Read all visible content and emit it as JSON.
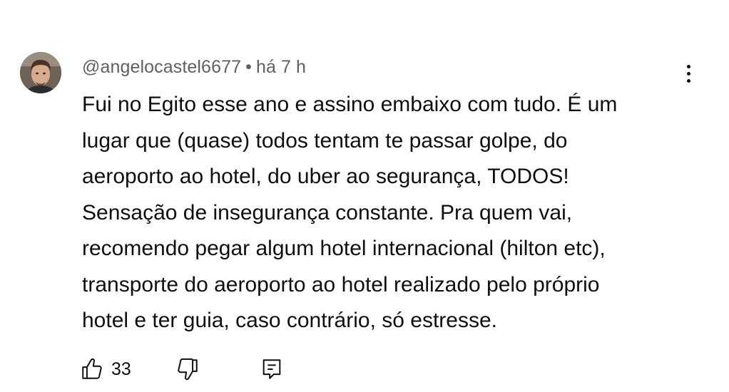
{
  "comment": {
    "author": "@angelocastel6677",
    "separator": "•",
    "time": "há 7 h",
    "text": "Fui no Egito esse ano e assino embaixo com tudo. É um\nlugar que (quase) todos tentam te passar golpe, do\naeroporto ao hotel, do uber ao segurança, TODOS!\nSensação de insegurança constante. Pra quem vai,\nrecomendo pegar algum hotel internacional (hilton etc),\ntransporte do aeroporto ao hotel realizado pelo próprio\nhotel e ter guia, caso contrário, só estresse.",
    "like_count": "33"
  },
  "icons": {
    "like": "thumbs-up-icon",
    "dislike": "thumbs-down-icon",
    "reply": "comment-icon",
    "more": "more-vertical-icon"
  }
}
